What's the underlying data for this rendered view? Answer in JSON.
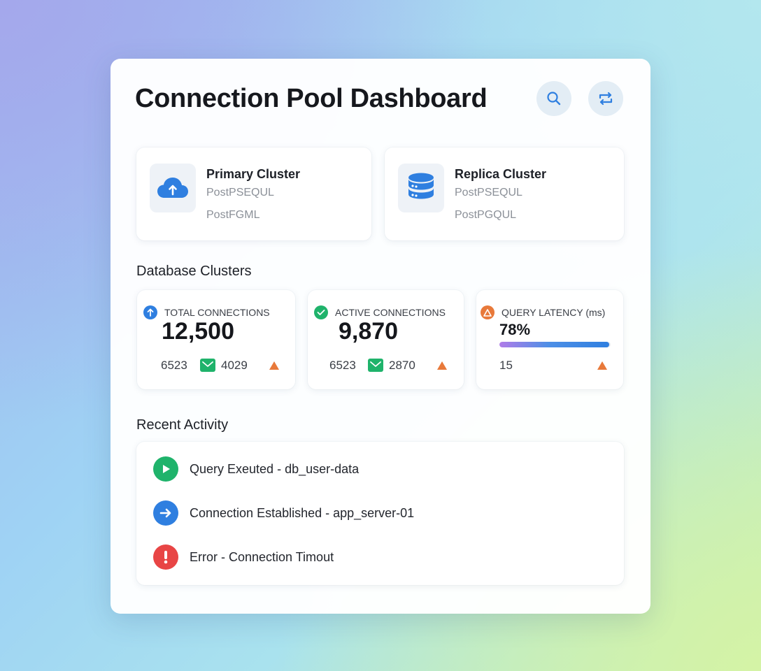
{
  "header": {
    "title": "Connection Pool Dashboard",
    "search_icon": "search-icon",
    "switch_icon": "swap-arrows-icon"
  },
  "clusters": [
    {
      "name": "Primary Cluster",
      "line1": "PostPSEQUL",
      "line2": "PostFGML",
      "icon": "cloud-upload-icon"
    },
    {
      "name": "Replica Cluster",
      "line1": "PostPSEQUL",
      "line2": "PostPGQUL",
      "icon": "database-icon"
    }
  ],
  "section_clusters": "Database Clusters",
  "stats": [
    {
      "label": "TOTAL CONNECTIONS",
      "value": "12,500",
      "foot_left": "6523",
      "foot_right": "4029",
      "icon": "arrow-up-icon"
    },
    {
      "label": "ACTIVE CONNECTIONS",
      "value": "9,870",
      "foot_left": "6523",
      "foot_right": "2870",
      "icon": "check-icon"
    },
    {
      "label": "QUERY LATENCY (ms)",
      "value": "78%",
      "progress": 0.99,
      "foot_left": "15",
      "icon": "warning-icon"
    }
  ],
  "section_activity": "Recent Activity",
  "activity": [
    {
      "text": "Query Exeuted - db_user-data",
      "icon": "play-icon",
      "color": "#1fb36b"
    },
    {
      "text": "Connection Established - app_server-01",
      "icon": "arrow-right-icon",
      "color": "#2f7fe0"
    },
    {
      "text": "Error - Connection Timout",
      "icon": "exclamation-icon",
      "color": "#e84545"
    }
  ],
  "colors": {
    "accent_blue": "#2f7fe0",
    "success_green": "#1fb36b",
    "warning_orange": "#e8793a",
    "error_red": "#e84545"
  }
}
